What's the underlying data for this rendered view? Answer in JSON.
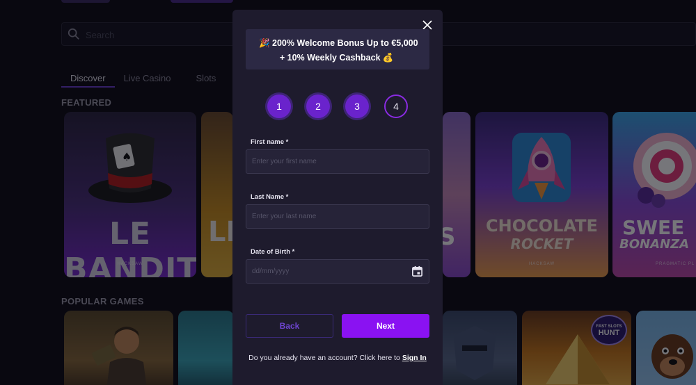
{
  "search": {
    "placeholder": "Search"
  },
  "tabs": [
    {
      "label": "Discover"
    },
    {
      "label": "Live Casino"
    },
    {
      "label": "Slots"
    }
  ],
  "sections": {
    "featured": "FEATURED",
    "popular": "POPULAR GAMES"
  },
  "featured_games": [
    {
      "title": "LE BANDIT",
      "provider": "HACKSAW"
    },
    {
      "title": "LE",
      "provider": ""
    },
    {
      "title": "S",
      "provider": ""
    },
    {
      "title": "CHOCOLATE",
      "subtitle": "ROCKET",
      "provider": "HACKSAW"
    },
    {
      "title": "SWEE",
      "subtitle": "BONANZA",
      "provider": "PRAGMATIC PL"
    }
  ],
  "popular_games": [
    {
      "badge": "FAST SLOTS",
      "badge2": "HUNT"
    }
  ],
  "modal": {
    "bonus_line1": "200% Welcome Bonus Up to €5,000",
    "bonus_line2": "+ 10% Weekly Cashback",
    "bonus_emoji1": "🎉",
    "bonus_emoji2": "💰",
    "steps": [
      "1",
      "2",
      "3",
      "4"
    ],
    "current_step": 4,
    "first_name": {
      "label": "First name *",
      "placeholder": "Enter your first name"
    },
    "last_name": {
      "label": "Last Name *",
      "placeholder": "Enter your last name"
    },
    "dob": {
      "label": "Date of Birth *",
      "placeholder": "dd/mm/yyyy"
    },
    "back_label": "Back",
    "next_label": "Next",
    "account_prompt": "Do you already have an account? Click here to",
    "signin_label": "Sign In"
  },
  "colors": {
    "accent": "#8a12f2",
    "bg": "#0e0c16",
    "modal_bg": "#1e1b2d"
  }
}
